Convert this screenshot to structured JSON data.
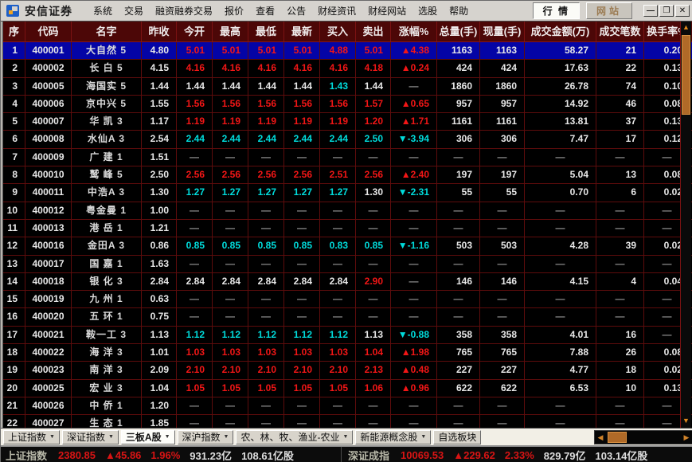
{
  "window": {
    "title": "安信证券"
  },
  "menu": {
    "items": [
      "系统",
      "交易",
      "融资融券交易",
      "报价",
      "查看",
      "公告",
      "财经资讯",
      "财经网站",
      "选股",
      "帮助"
    ]
  },
  "titlebar": {
    "quotes_button": "行 情",
    "website_button": "网站",
    "minimize_icon": "—",
    "maximize_icon": "❒",
    "close_icon": "✕"
  },
  "icons": {
    "scroll_up": "▲",
    "scroll_down": "▼",
    "scroll_left": "◀",
    "scroll_right": "▶",
    "dropdown": "▼"
  },
  "table": {
    "columns": [
      "序",
      "代码",
      "名字",
      "昨收",
      "今开",
      "最高",
      "最低",
      "最新",
      "买入",
      "卖出",
      "涨幅%",
      "总量(手)",
      "现量(手)",
      "成交金额(万)",
      "成交笔数",
      "换手率%"
    ],
    "rows": [
      {
        "selected": true,
        "colors": "wwnwuuuuuuuwwwww",
        "cells": [
          "1",
          "400001",
          "大自然 5",
          "4.80",
          "5.01",
          "5.01",
          "5.01",
          "5.01",
          "4.88",
          "5.01",
          "▲4.38",
          "1163",
          "1163",
          "58.27",
          "21",
          "0.20"
        ]
      },
      {
        "selected": false,
        "colors": "wwnwuuuuuuuwwwww",
        "cells": [
          "2",
          "400002",
          "长 白 5",
          "4.15",
          "4.16",
          "4.16",
          "4.16",
          "4.16",
          "4.16",
          "4.18",
          "▲0.24",
          "424",
          "424",
          "17.63",
          "22",
          "0.13"
        ]
      },
      {
        "selected": false,
        "colors": "wwnwwwwwdwgwwwww",
        "cells": [
          "3",
          "400005",
          "海国实 5",
          "1.44",
          "1.44",
          "1.44",
          "1.44",
          "1.44",
          "1.43",
          "1.44",
          "—",
          "1860",
          "1860",
          "26.78",
          "74",
          "0.10"
        ]
      },
      {
        "selected": false,
        "colors": "wwnwuuuuuuuwwwww",
        "cells": [
          "4",
          "400006",
          "京中兴 5",
          "1.55",
          "1.56",
          "1.56",
          "1.56",
          "1.56",
          "1.56",
          "1.57",
          "▲0.65",
          "957",
          "957",
          "14.92",
          "46",
          "0.08"
        ]
      },
      {
        "selected": false,
        "colors": "wwnwuuuuuuuwwwww",
        "cells": [
          "5",
          "400007",
          "华 凯 3",
          "1.17",
          "1.19",
          "1.19",
          "1.19",
          "1.19",
          "1.19",
          "1.20",
          "▲1.71",
          "1161",
          "1161",
          "13.81",
          "37",
          "0.13"
        ]
      },
      {
        "selected": false,
        "colors": "wwnwdddddddwwwww",
        "cells": [
          "6",
          "400008",
          "水仙A 3",
          "2.54",
          "2.44",
          "2.44",
          "2.44",
          "2.44",
          "2.44",
          "2.50",
          "▼-3.94",
          "306",
          "306",
          "7.47",
          "17",
          "0.12"
        ]
      },
      {
        "selected": false,
        "colors": "wwnwgggggggggggg",
        "cells": [
          "7",
          "400009",
          "广 建 1",
          "1.51",
          "—",
          "—",
          "—",
          "—",
          "—",
          "—",
          "—",
          "—",
          "—",
          "—",
          "—",
          "—"
        ]
      },
      {
        "selected": false,
        "colors": "wwnwuuuuuuuwwwww",
        "cells": [
          "8",
          "400010",
          "鹫 峰 5",
          "2.50",
          "2.56",
          "2.56",
          "2.56",
          "2.56",
          "2.51",
          "2.56",
          "▲2.40",
          "197",
          "197",
          "5.04",
          "13",
          "0.08"
        ]
      },
      {
        "selected": false,
        "colors": "wwnwdddddwdwwwww",
        "cells": [
          "9",
          "400011",
          "中浩A 3",
          "1.30",
          "1.27",
          "1.27",
          "1.27",
          "1.27",
          "1.27",
          "1.30",
          "▼-2.31",
          "55",
          "55",
          "0.70",
          "6",
          "0.02"
        ]
      },
      {
        "selected": false,
        "colors": "wwnwgggggggggggg",
        "cells": [
          "10",
          "400012",
          "粤金曼 1",
          "1.00",
          "—",
          "—",
          "—",
          "—",
          "—",
          "—",
          "—",
          "—",
          "—",
          "—",
          "—",
          "—"
        ]
      },
      {
        "selected": false,
        "colors": "wwnwgggggggggggg",
        "cells": [
          "11",
          "400013",
          "港 岳 1",
          "1.21",
          "—",
          "—",
          "—",
          "—",
          "—",
          "—",
          "—",
          "—",
          "—",
          "—",
          "—",
          "—"
        ]
      },
      {
        "selected": false,
        "colors": "wwnwdddddddwwwww",
        "cells": [
          "12",
          "400016",
          "金田A 3",
          "0.86",
          "0.85",
          "0.85",
          "0.85",
          "0.85",
          "0.83",
          "0.85",
          "▼-1.16",
          "503",
          "503",
          "4.28",
          "39",
          "0.02"
        ]
      },
      {
        "selected": false,
        "colors": "wwnwgggggggggggg",
        "cells": [
          "13",
          "400017",
          "国 嘉 1",
          "1.63",
          "—",
          "—",
          "—",
          "—",
          "—",
          "—",
          "—",
          "—",
          "—",
          "—",
          "—",
          "—"
        ]
      },
      {
        "selected": false,
        "colors": "wwnwwwwwwugwwwww",
        "cells": [
          "14",
          "400018",
          "银 化 3",
          "2.84",
          "2.84",
          "2.84",
          "2.84",
          "2.84",
          "2.84",
          "2.90",
          "—",
          "146",
          "146",
          "4.15",
          "4",
          "0.04"
        ]
      },
      {
        "selected": false,
        "colors": "wwnwgggggggggggg",
        "cells": [
          "15",
          "400019",
          "九 州 1",
          "0.63",
          "—",
          "—",
          "—",
          "—",
          "—",
          "—",
          "—",
          "—",
          "—",
          "—",
          "—",
          "—"
        ]
      },
      {
        "selected": false,
        "colors": "wwnwgggggggggggg",
        "cells": [
          "16",
          "400020",
          "五 环 1",
          "0.75",
          "—",
          "—",
          "—",
          "—",
          "—",
          "—",
          "—",
          "—",
          "—",
          "—",
          "—",
          "—"
        ]
      },
      {
        "selected": false,
        "colors": "wwnwdddddwdwwwwg",
        "cells": [
          "17",
          "400021",
          "鞍一工 3",
          "1.13",
          "1.12",
          "1.12",
          "1.12",
          "1.12",
          "1.12",
          "1.13",
          "▼-0.88",
          "358",
          "358",
          "4.01",
          "16",
          "—"
        ]
      },
      {
        "selected": false,
        "colors": "wwnwuuuuuuuwwwww",
        "cells": [
          "18",
          "400022",
          "海 洋 3",
          "1.01",
          "1.03",
          "1.03",
          "1.03",
          "1.03",
          "1.03",
          "1.04",
          "▲1.98",
          "765",
          "765",
          "7.88",
          "26",
          "0.08"
        ]
      },
      {
        "selected": false,
        "colors": "wwnwuuuuuuuwwwww",
        "cells": [
          "19",
          "400023",
          "南 洋 3",
          "2.09",
          "2.10",
          "2.10",
          "2.10",
          "2.10",
          "2.10",
          "2.13",
          "▲0.48",
          "227",
          "227",
          "4.77",
          "18",
          "0.02"
        ]
      },
      {
        "selected": false,
        "colors": "wwnwuuuuuuuwwwww",
        "cells": [
          "20",
          "400025",
          "宏 业 3",
          "1.04",
          "1.05",
          "1.05",
          "1.05",
          "1.05",
          "1.05",
          "1.06",
          "▲0.96",
          "622",
          "622",
          "6.53",
          "10",
          "0.13"
        ]
      },
      {
        "selected": false,
        "colors": "wwnwgggggggggggg",
        "cells": [
          "21",
          "400026",
          "中 侨 1",
          "1.20",
          "—",
          "—",
          "—",
          "—",
          "—",
          "—",
          "—",
          "—",
          "—",
          "—",
          "—",
          "—"
        ]
      },
      {
        "selected": false,
        "colors": "wwnwgggggggggggg",
        "cells": [
          "22",
          "400027",
          "生 态 1",
          "1.85",
          "—",
          "—",
          "—",
          "—",
          "—",
          "—",
          "—",
          "—",
          "—",
          "—",
          "—",
          "—"
        ]
      }
    ]
  },
  "tabs": {
    "items": [
      {
        "label": "上证指数",
        "dropdown": true,
        "active": false
      },
      {
        "label": "深证指数",
        "dropdown": true,
        "active": false
      },
      {
        "label": "三板A股",
        "dropdown": true,
        "active": true
      },
      {
        "label": "深沪指数",
        "dropdown": true,
        "active": false
      },
      {
        "label": "农、林、牧、渔业-农业",
        "dropdown": true,
        "active": false
      },
      {
        "label": "新能源概念股",
        "dropdown": true,
        "active": false
      },
      {
        "label": "自选板块",
        "dropdown": false,
        "active": false
      }
    ]
  },
  "status": {
    "left": {
      "name": "上证指数",
      "value": "2380.85",
      "change": "▲45.86",
      "pct": "1.96%",
      "amount": "931.23亿",
      "volume": "108.61亿股"
    },
    "right": {
      "name": "深证成指",
      "value": "10069.53",
      "change": "▲229.62",
      "pct": "2.33%",
      "amount": "829.79亿",
      "volume": "103.14亿股"
    }
  },
  "colors": {
    "up": "#f21616",
    "down": "#00dcdc",
    "neutral": "#e8e8e8",
    "dash": "#8f8f8f",
    "header_bg": "#4c0707",
    "grid": "#5e0c0c",
    "selected_bg": "#0404a6",
    "scroll_thumb": "#b06a28",
    "titlebar_bg": "#d6d3ce",
    "status_red": "#d81414"
  }
}
